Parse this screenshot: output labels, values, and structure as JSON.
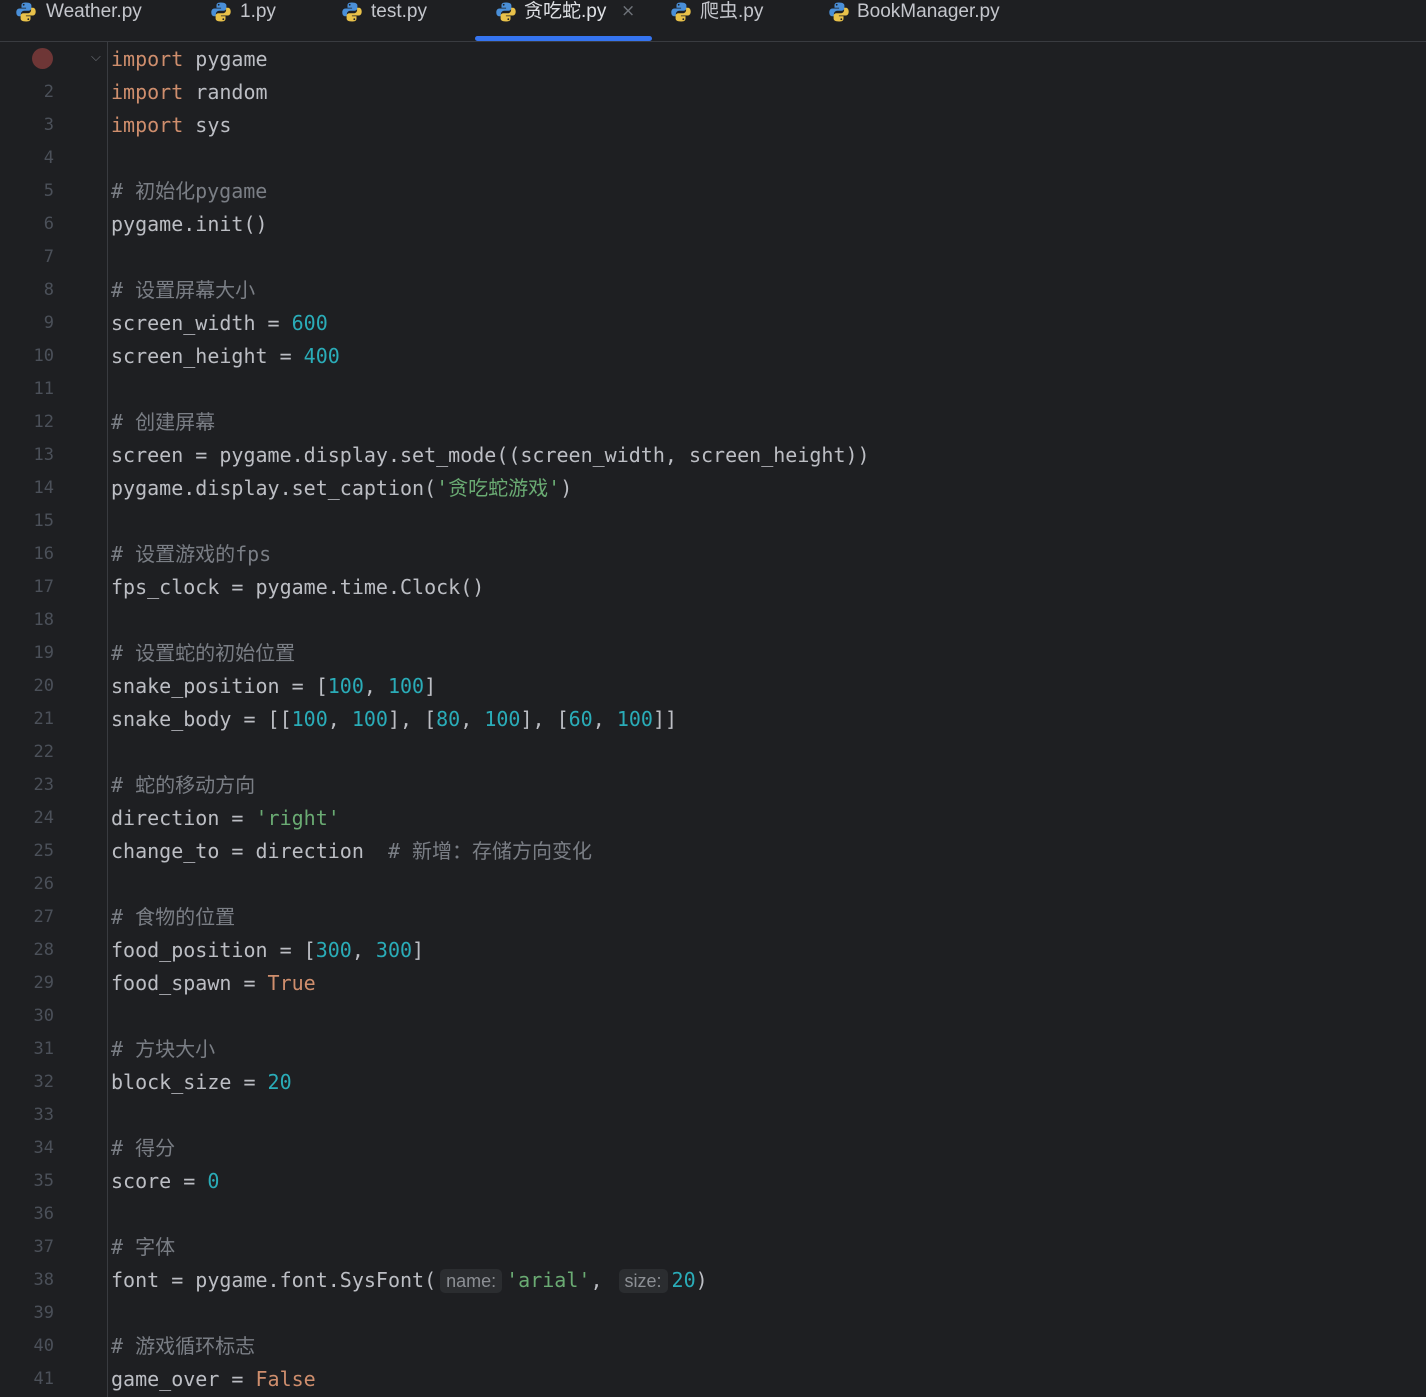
{
  "colors": {
    "background": "#1e1f22",
    "keyword": "#cf8e6d",
    "text": "#bcbec4",
    "number": "#2aacb8",
    "string": "#6aab73",
    "comment": "#7a7e85",
    "line_number": "#4b5059",
    "accent": "#3574f0",
    "breakpoint": "#6e3636"
  },
  "tabs": [
    {
      "label": "Weather.py",
      "icon": "python-icon",
      "active": false
    },
    {
      "label": "1.py",
      "icon": "python-icon",
      "active": false
    },
    {
      "label": "test.py",
      "icon": "python-icon",
      "active": false
    },
    {
      "label": "贪吃蛇.py",
      "icon": "python-icon",
      "active": true,
      "close": "×"
    },
    {
      "label": "爬虫.py",
      "icon": "python-icon",
      "active": false
    },
    {
      "label": "BookManager.py",
      "icon": "python-icon",
      "active": false
    }
  ],
  "editor": {
    "breakpoint_line": 1,
    "lines": [
      {
        "n": "1",
        "t": [
          [
            "kw",
            "import"
          ],
          [
            "tx",
            " pygame"
          ]
        ]
      },
      {
        "n": "2",
        "t": [
          [
            "kw",
            "import"
          ],
          [
            "tx",
            " random"
          ]
        ]
      },
      {
        "n": "3",
        "t": [
          [
            "kw",
            "import"
          ],
          [
            "tx",
            " sys"
          ]
        ]
      },
      {
        "n": "4",
        "t": []
      },
      {
        "n": "5",
        "t": [
          [
            "cm",
            "# 初始化pygame"
          ]
        ]
      },
      {
        "n": "6",
        "t": [
          [
            "tx",
            "pygame.init()"
          ]
        ]
      },
      {
        "n": "7",
        "t": []
      },
      {
        "n": "8",
        "t": [
          [
            "cm",
            "# 设置屏幕大小"
          ]
        ]
      },
      {
        "n": "9",
        "t": [
          [
            "tx",
            "screen_width = "
          ],
          [
            "num",
            "600"
          ]
        ]
      },
      {
        "n": "10",
        "t": [
          [
            "tx",
            "screen_height = "
          ],
          [
            "num",
            "400"
          ]
        ]
      },
      {
        "n": "11",
        "t": []
      },
      {
        "n": "12",
        "t": [
          [
            "cm",
            "# 创建屏幕"
          ]
        ]
      },
      {
        "n": "13",
        "t": [
          [
            "tx",
            "screen = pygame.display.set_mode((screen_width, screen_height))"
          ]
        ]
      },
      {
        "n": "14",
        "t": [
          [
            "tx",
            "pygame.display.set_caption("
          ],
          [
            "str",
            "'贪吃蛇游戏'"
          ],
          [
            "tx",
            ")"
          ]
        ]
      },
      {
        "n": "15",
        "t": []
      },
      {
        "n": "16",
        "t": [
          [
            "cm",
            "# 设置游戏的fps"
          ]
        ]
      },
      {
        "n": "17",
        "t": [
          [
            "tx",
            "fps_clock = pygame.time.Clock()"
          ]
        ]
      },
      {
        "n": "18",
        "t": []
      },
      {
        "n": "19",
        "t": [
          [
            "cm",
            "# 设置蛇的初始位置"
          ]
        ]
      },
      {
        "n": "20",
        "t": [
          [
            "tx",
            "snake_position = ["
          ],
          [
            "num",
            "100"
          ],
          [
            "tx",
            ", "
          ],
          [
            "num",
            "100"
          ],
          [
            "tx",
            "]"
          ]
        ]
      },
      {
        "n": "21",
        "t": [
          [
            "tx",
            "snake_body = [["
          ],
          [
            "num",
            "100"
          ],
          [
            "tx",
            ", "
          ],
          [
            "num",
            "100"
          ],
          [
            "tx",
            "], ["
          ],
          [
            "num",
            "80"
          ],
          [
            "tx",
            ", "
          ],
          [
            "num",
            "100"
          ],
          [
            "tx",
            "], ["
          ],
          [
            "num",
            "60"
          ],
          [
            "tx",
            ", "
          ],
          [
            "num",
            "100"
          ],
          [
            "tx",
            "]]"
          ]
        ]
      },
      {
        "n": "22",
        "t": []
      },
      {
        "n": "23",
        "t": [
          [
            "cm",
            "# 蛇的移动方向"
          ]
        ]
      },
      {
        "n": "24",
        "t": [
          [
            "tx",
            "direction = "
          ],
          [
            "str",
            "'right'"
          ]
        ]
      },
      {
        "n": "25",
        "t": [
          [
            "tx",
            "change_to = direction  "
          ],
          [
            "cm",
            "# 新增：存储方向变化"
          ]
        ]
      },
      {
        "n": "26",
        "t": []
      },
      {
        "n": "27",
        "t": [
          [
            "cm",
            "# 食物的位置"
          ]
        ]
      },
      {
        "n": "28",
        "t": [
          [
            "tx",
            "food_position = ["
          ],
          [
            "num",
            "300"
          ],
          [
            "tx",
            ", "
          ],
          [
            "num",
            "300"
          ],
          [
            "tx",
            "]"
          ]
        ]
      },
      {
        "n": "29",
        "t": [
          [
            "tx",
            "food_spawn = "
          ],
          [
            "kw",
            "True"
          ]
        ]
      },
      {
        "n": "30",
        "t": []
      },
      {
        "n": "31",
        "t": [
          [
            "cm",
            "# 方块大小"
          ]
        ]
      },
      {
        "n": "32",
        "t": [
          [
            "tx",
            "block_size = "
          ],
          [
            "num",
            "20"
          ]
        ]
      },
      {
        "n": "33",
        "t": []
      },
      {
        "n": "34",
        "t": [
          [
            "cm",
            "# 得分"
          ]
        ]
      },
      {
        "n": "35",
        "t": [
          [
            "tx",
            "score = "
          ],
          [
            "num",
            "0"
          ]
        ]
      },
      {
        "n": "36",
        "t": []
      },
      {
        "n": "37",
        "t": [
          [
            "cm",
            "# 字体"
          ]
        ]
      },
      {
        "n": "38",
        "t": [
          [
            "tx",
            "font = pygame.font.SysFont("
          ],
          [
            "hint",
            "name:"
          ],
          [
            "str",
            "'arial'"
          ],
          [
            "tx",
            ", "
          ],
          [
            "hint",
            "size:"
          ],
          [
            "num",
            "20"
          ],
          [
            "tx",
            ")"
          ]
        ]
      },
      {
        "n": "39",
        "t": []
      },
      {
        "n": "40",
        "t": [
          [
            "cm",
            "# 游戏循环标志"
          ]
        ]
      },
      {
        "n": "41",
        "t": [
          [
            "tx",
            "game_over = "
          ],
          [
            "kw",
            "False"
          ]
        ]
      }
    ]
  }
}
